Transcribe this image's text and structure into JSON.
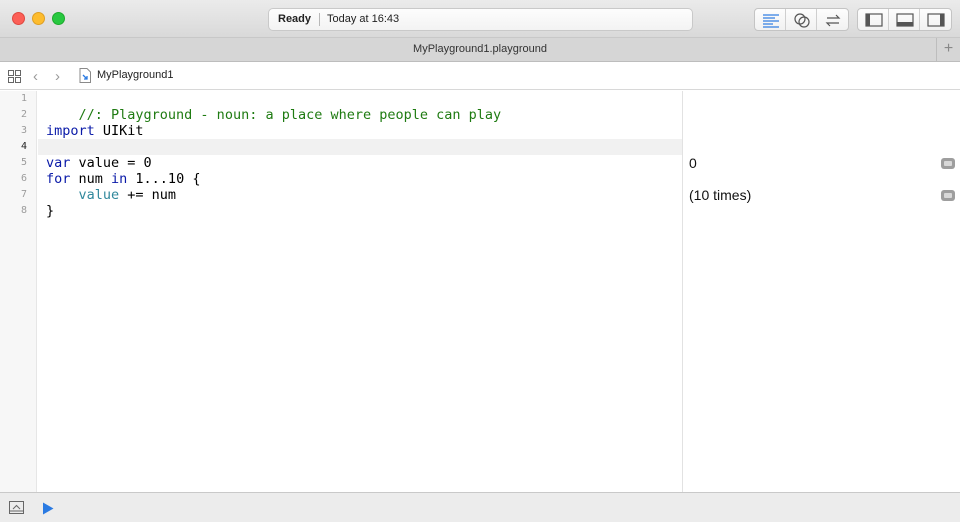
{
  "window": {
    "activity_status": "Ready",
    "activity_time": "Today at 16:43"
  },
  "toolbar": {
    "editor_buttons": [
      "standard-editor-icon",
      "assistant-editor-icon",
      "version-editor-icon"
    ],
    "panel_buttons": [
      "navigator-panel-icon",
      "debug-area-icon",
      "utilities-panel-icon"
    ],
    "accent_color": "#2a7ae2"
  },
  "tab": {
    "title": "MyPlayground1.playground",
    "add_label": "+"
  },
  "jumpbar": {
    "back_label": "‹",
    "forward_label": "›",
    "breadcrumb": "MyPlayground1"
  },
  "editor": {
    "line_numbers": [
      "1",
      "2",
      "3",
      "4",
      "5",
      "6",
      "7",
      "8"
    ],
    "current_line": "4",
    "lines": {
      "l1_comment": "//: Playground - noun: a place where people can play",
      "l3_keyword": "import",
      "l3_rest": " UIKit",
      "l5_keyword": "var",
      "l5_rest": " value = 0",
      "l6_keyword_for": "for",
      "l6_mid": " num ",
      "l6_keyword_in": "in",
      "l6_rest": " 1...10 {",
      "l7_indent": "    ",
      "l7_var": "value",
      "l7_rest": " += num",
      "l8_text": "}"
    }
  },
  "results": {
    "line5": "0",
    "line7": "(10 times)"
  },
  "bottom": {
    "debug_icon": "show-debug-area-icon",
    "run_icon": "run-play-icon"
  }
}
